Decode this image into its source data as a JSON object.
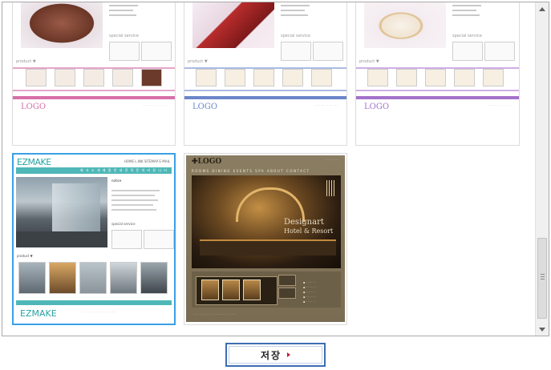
{
  "templates": [
    {
      "id": "cake",
      "logo": "LOGO",
      "accent": "#d86fa8",
      "labels": {
        "special": "special service",
        "product": "product ▼"
      }
    },
    {
      "id": "jewelry-blue",
      "logo": "LOGO",
      "accent": "#6b86c9",
      "labels": {
        "special": "special service",
        "product": "product ▼"
      }
    },
    {
      "id": "jewelry-purple",
      "logo": "LOGO",
      "accent": "#a372c9",
      "labels": {
        "special": "special service",
        "product": "product ▼"
      }
    },
    {
      "id": "ezmake",
      "selected": true,
      "logo": "EZMAKE",
      "footer_logo": "EZMAKE",
      "top_links": "HOME  L.INK  SITEMAP  E-MAIL",
      "nav": "회 사 소 개   제 품 안 내   견 적 문 의   커 뮤 니 티",
      "notice": "notice",
      "special": "special service",
      "product": "product ▼",
      "accent": "#4fb7b7"
    },
    {
      "id": "hotel",
      "logo": "✚LOGO",
      "design_line1": "Designart",
      "design_line2": "Hotel & Resort",
      "nav": "ROOMS  DINING  EVENTS  SPA  ABOUT  CONTACT",
      "accent": "#7a6c52"
    }
  ],
  "save_button": {
    "label": "저장"
  }
}
